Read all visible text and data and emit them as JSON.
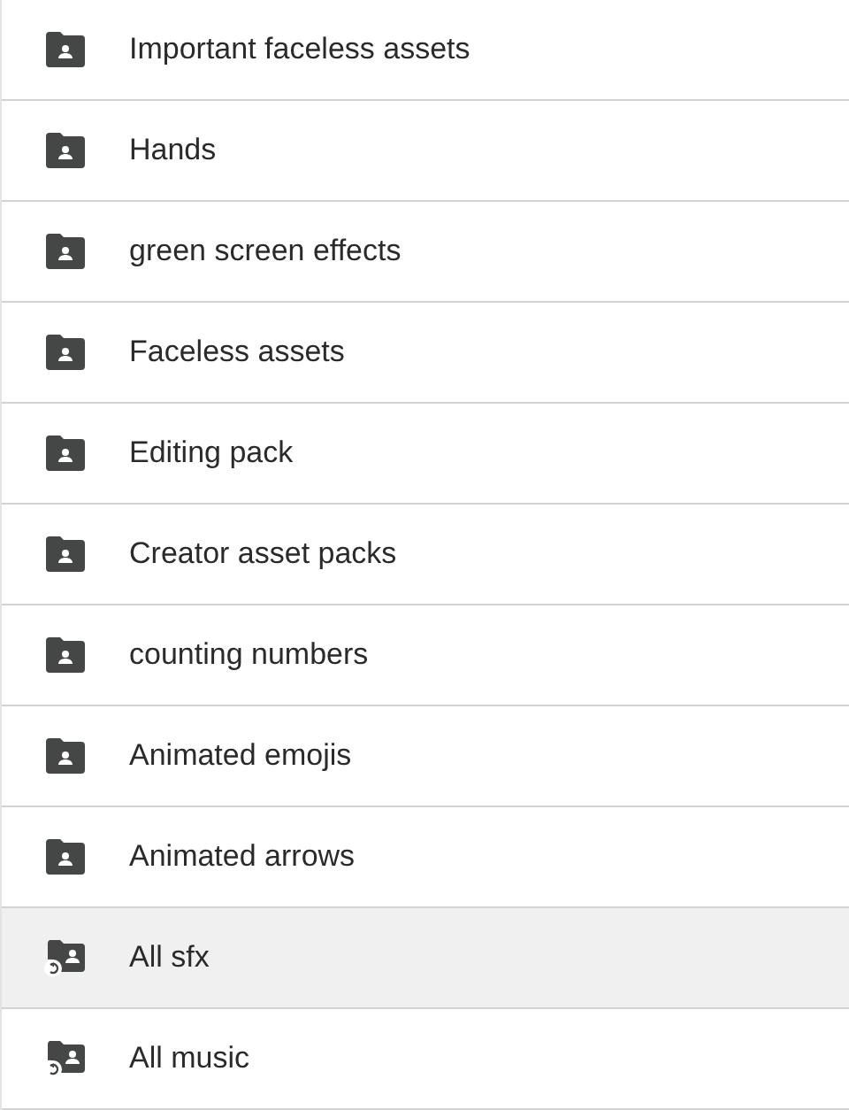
{
  "folders": [
    {
      "name": "Important faceless assets",
      "kind": "shared",
      "selected": false
    },
    {
      "name": "Hands",
      "kind": "shared",
      "selected": false
    },
    {
      "name": "green screen effects",
      "kind": "shared",
      "selected": false
    },
    {
      "name": "Faceless assets",
      "kind": "shared",
      "selected": false
    },
    {
      "name": "Editing pack",
      "kind": "shared",
      "selected": false
    },
    {
      "name": "Creator asset packs",
      "kind": "shared",
      "selected": false
    },
    {
      "name": "counting numbers",
      "kind": "shared",
      "selected": false
    },
    {
      "name": "Animated emojis",
      "kind": "shared",
      "selected": false
    },
    {
      "name": "Animated arrows",
      "kind": "shared",
      "selected": false
    },
    {
      "name": "All sfx",
      "kind": "shortcut",
      "selected": true
    },
    {
      "name": "All music",
      "kind": "shortcut",
      "selected": false
    }
  ]
}
